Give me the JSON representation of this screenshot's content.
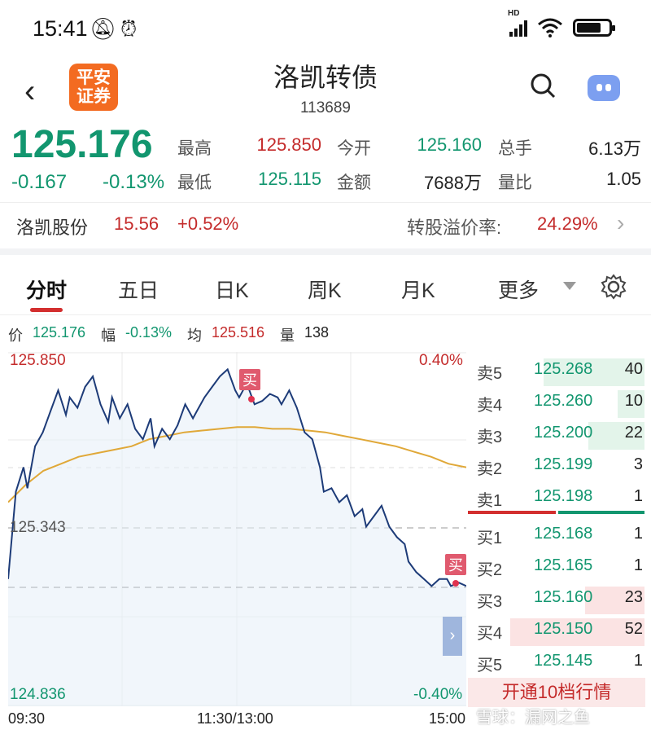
{
  "status_bar": {
    "time": "15:41",
    "hd_label": "HD"
  },
  "header": {
    "back_icon": "‹",
    "logo_line1": "平安",
    "logo_line2": "证券",
    "title": "洛凯转债",
    "code": "113689"
  },
  "quote": {
    "price": "125.176",
    "change": "-0.167",
    "change_pct": "-0.13%",
    "high_label": "最高",
    "high": "125.850",
    "open_label": "今开",
    "open": "125.160",
    "volume_label": "总手",
    "volume": "6.13万",
    "low_label": "最低",
    "low": "125.115",
    "amount_label": "金额",
    "amount": "7688万",
    "ratio_label": "量比",
    "ratio": "1.05"
  },
  "stock": {
    "name": "洛凯股份",
    "price": "15.56",
    "change_pct": "+0.52%",
    "premium_label": "转股溢价率:",
    "premium": "24.29%"
  },
  "tabs": [
    {
      "label": "分时"
    },
    {
      "label": "五日"
    },
    {
      "label": "日K"
    },
    {
      "label": "周K"
    },
    {
      "label": "月K"
    },
    {
      "label": "更多"
    }
  ],
  "info_bar": {
    "price_label": "价",
    "price": "125.176",
    "pct_label": "幅",
    "pct": "-0.13%",
    "avg_label": "均",
    "avg": "125.516",
    "vol_label": "量",
    "vol": "138"
  },
  "chart_labels": {
    "top_price": "125.850",
    "mid_price": "125.343",
    "bottom_price": "124.836",
    "top_pct": "0.40%",
    "bottom_pct": "-0.40%",
    "buy_marker": "买",
    "x_start": "09:30",
    "x_mid": "11:30/13:00",
    "x_end": "15:00"
  },
  "order_book": {
    "asks": [
      {
        "label": "卖5",
        "price": "125.268",
        "vol": "40",
        "depth": 0.75
      },
      {
        "label": "卖4",
        "price": "125.260",
        "vol": "10",
        "depth": 0.2
      },
      {
        "label": "卖3",
        "price": "125.200",
        "vol": "22",
        "depth": 0.42
      },
      {
        "label": "卖2",
        "price": "125.199",
        "vol": "3",
        "depth": 0.0
      },
      {
        "label": "卖1",
        "price": "125.198",
        "vol": "1",
        "depth": 0.0
      }
    ],
    "bids": [
      {
        "label": "买1",
        "price": "125.168",
        "vol": "1",
        "depth": 0.0
      },
      {
        "label": "买2",
        "price": "125.165",
        "vol": "1",
        "depth": 0.0
      },
      {
        "label": "买3",
        "price": "125.160",
        "vol": "23",
        "depth": 0.44
      },
      {
        "label": "买4",
        "price": "125.150",
        "vol": "52",
        "depth": 1.0
      },
      {
        "label": "买5",
        "price": "125.145",
        "vol": "1",
        "depth": 0.0
      }
    ],
    "open_button": "开通10档行情"
  },
  "watermark": "雪球：漏网之鱼",
  "chart_data": {
    "type": "line",
    "ylim": [
      124.836,
      125.85
    ],
    "reference": 125.343,
    "series": [
      {
        "values": [
          125.2,
          125.45,
          125.52,
          125.46,
          125.58,
          125.62,
          125.68,
          125.74,
          125.67,
          125.72,
          125.69,
          125.75,
          125.78,
          125.7,
          125.65,
          125.72,
          125.66,
          125.7,
          125.63,
          125.6,
          125.66,
          125.58,
          125.63,
          125.6,
          125.64,
          125.7,
          125.66,
          125.68,
          125.72,
          125.75,
          125.78,
          125.8,
          125.74,
          125.72,
          125.76,
          125.7,
          125.71,
          125.73,
          125.72,
          125.7,
          125.74,
          125.69,
          125.62,
          125.6,
          125.52,
          125.45,
          125.46,
          125.42,
          125.44,
          125.38,
          125.4,
          125.35,
          125.38,
          125.41,
          125.35,
          125.32,
          125.3,
          125.25,
          125.22,
          125.2,
          125.18,
          125.2,
          125.2,
          125.18,
          125.19,
          125.18
        ]
      },
      {
        "values": [
          125.42,
          125.47,
          125.51,
          125.53,
          125.55,
          125.56,
          125.57,
          125.58,
          125.6,
          125.61,
          125.62,
          125.625,
          125.63,
          125.635,
          125.635,
          125.63,
          125.63,
          125.625,
          125.62,
          125.61,
          125.6,
          125.59,
          125.58,
          125.565,
          125.55,
          125.53,
          125.52
        ]
      }
    ]
  }
}
